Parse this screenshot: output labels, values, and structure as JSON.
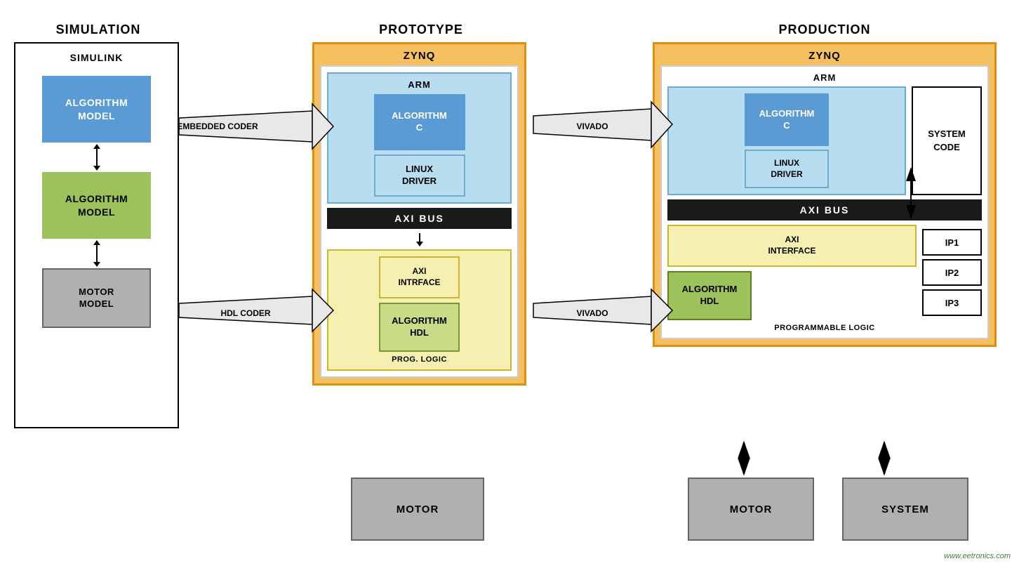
{
  "sections": {
    "simulation": {
      "title": "SIMULATION",
      "box_label": "SIMULINK",
      "algo_model_1": "ALGORITHM\nMODEL",
      "algo_model_2": "ALGORITHM\nMODEL",
      "motor_model": "MOTOR\nMODEL"
    },
    "prototype": {
      "title": "PROTOTYPE",
      "zynq_label": "ZYNQ",
      "arm_label": "ARM",
      "algorithm_c": "ALGORITHM\nC",
      "linux_driver": "LINUX\nDRIVER",
      "axi_bus": "AXI BUS",
      "axi_interface": "AXI\nINTRFACE",
      "algorithm_hdl": "ALGORITHM\nHDL",
      "prog_logic": "PROG. LOGIC",
      "motor": "MOTOR"
    },
    "production": {
      "title": "PRODUCTION",
      "zynq_label": "ZYNQ",
      "arm_label": "ARM",
      "algorithm_c": "ALGORITHM\nC",
      "linux_driver": "LINUX\nDRIVER",
      "system_code": "SYSTEM\nCODE",
      "axi_bus": "AXI BUS",
      "axi_interface": "AXI\nINTERFACE",
      "algorithm_hdl": "ALGORITHM\nHDL",
      "programmable_logic": "PROGRAMMABLE LOGIC",
      "ip1": "IP1",
      "ip2": "IP2",
      "ip3": "IP3",
      "motor": "MOTOR",
      "system": "SYSTEM"
    }
  },
  "arrows": {
    "embedded_coder": "EMBEDDED CODER",
    "hdl_coder": "HDL CODER",
    "vivado_top": "VIVADO",
    "vivado_bottom": "VIVADO"
  },
  "watermark": "www.eetronics.com"
}
